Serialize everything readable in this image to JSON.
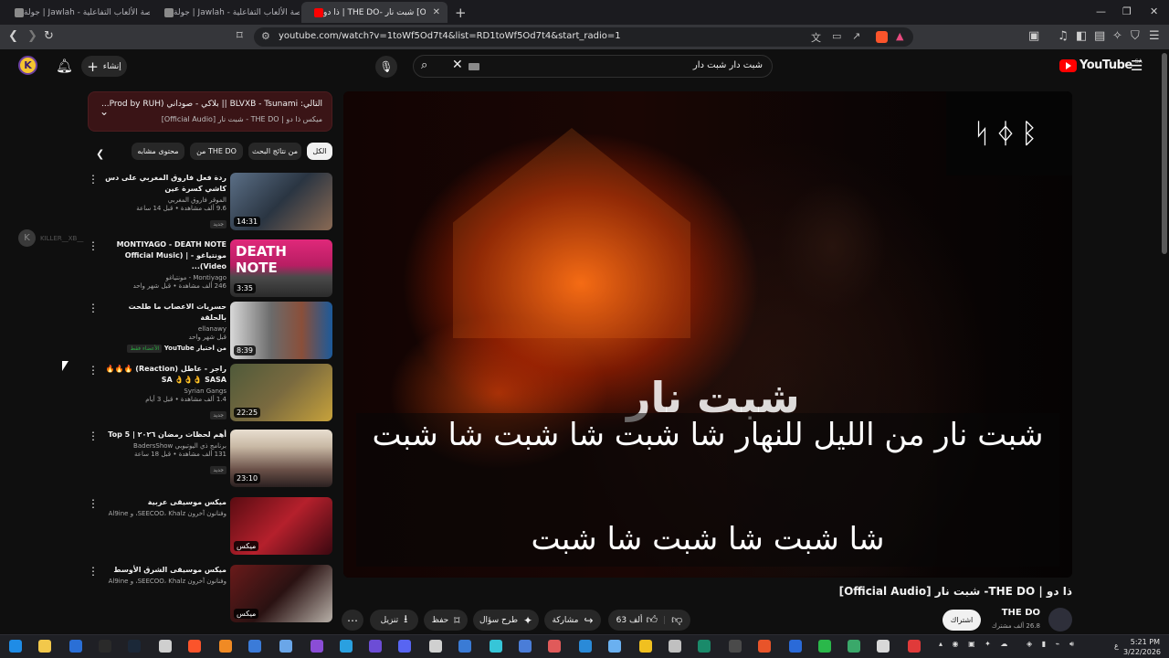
{
  "browser": {
    "tabs": [
      {
        "title": "جولة | Jawlah - منصة الألعاب التفاعلية",
        "active": false
      },
      {
        "title": "جولة | Jawlah - منصة الألعاب التفاعلية",
        "active": false
      },
      {
        "title": "ذا دو | THE DO- شبت نار [Official Audio]",
        "active": true
      }
    ],
    "url": "youtube.com/watch?v=1toWf5Od7t4&list=RD1toWf5Od7t4&start_radio=1"
  },
  "masthead": {
    "avatar_letter": "K",
    "create_label": "إنشاء",
    "search_query": "شبت دار شبت دار",
    "logo_text": "YouTube",
    "logo_country": "SA"
  },
  "upnext": {
    "line1": "التالي: BLVXB - Tsunami || بلاكي - صوداني (Prod by RUH...",
    "line2": "ميكس ذا دو | THE DO - شبت نار [Official Audio]"
  },
  "chips": [
    "الكل",
    "من نتائج البحث",
    "من THE DO",
    "محتوى مشابه"
  ],
  "sidebar_user": {
    "avatar": "K",
    "name": "KILLER__XB__"
  },
  "videos": [
    {
      "title": "ردة فعل فاروق المغربي على دس كاشي كسرة عين",
      "channel": "الموقر فاروق المغربي",
      "meta": "9.6 ألف مشاهدة • قبل 14 ساعة",
      "badge": "جديد",
      "duration": "14:31"
    },
    {
      "title": "MONTIYAGO - DEATH NOTE مونتياغو - | (Official Music Video)...",
      "channel": "Montiyago - مونتياغو",
      "meta": "246 ألف مشاهدة • قبل شهر واحد",
      "badge": "",
      "duration": "3:35"
    },
    {
      "title": "حسريات الاعصاب ما طلحت بالحلقة",
      "channel": "ellanawy",
      "meta": "قبل شهر واحد",
      "badge": "الأعضاء فقط",
      "extra": "من اختيار YouTube",
      "duration": "8:39"
    },
    {
      "title": "راجر - عاطل (Reaction) 🔥🔥🔥 SA 👌👌👌 SASA",
      "channel": "Syrian Gangs",
      "meta": "1.4 ألف مشاهدة • قبل 3 أيام",
      "badge": "جديد",
      "duration": "22:25"
    },
    {
      "title": "أهم لحظات رمضان ٢٠٢٦ | Top 5",
      "channel": "برنامج ذي اليوتيوبي BadersShow",
      "meta": "131 ألف مشاهدة • قبل 18 ساعة",
      "badge": "جديد",
      "duration": "23:10"
    },
    {
      "title": "ميكس موسيقى عربية",
      "channel": "وفنانون آخرون SEECOO، Khalz، و Al9ine",
      "meta": "",
      "badge": "",
      "duration": "ميكس"
    },
    {
      "title": "ميكس موسيقى الشرق الأوسط",
      "channel": "وفنانون آخرون SEECOO، Khalz، و Al9ine",
      "meta": "",
      "badge": "",
      "duration": "ميكس"
    }
  ],
  "player": {
    "logo_glyphs": "ᛋᛄᛒ",
    "overlay_text": "شبت نار",
    "subtitle_line1": "شبت نار من الليل للنهار شا شبت شا شبت شا شبت",
    "subtitle_line2": "شا شبت شا شبت شا شبت"
  },
  "video": {
    "title": "ذا دو | THE DO- شبت نار [Official Audio]",
    "channel_name": "THE DO",
    "channel_subs": "26.8 ألف مشترك",
    "subscribe_label": "اشتراك",
    "likes": "63 ألف",
    "share_label": "مشاركة",
    "ask_label": "طرح سؤال",
    "save_label": "حفظ",
    "download_label": "تنزيل"
  },
  "taskbar": {
    "time": "5:21 PM",
    "date": "3/22/2026",
    "lang": "ع"
  },
  "colors": {
    "accent_red": "#ff0000",
    "bg": "#0f0f0f",
    "chip_bg": "#272727",
    "upnext_bg": "#3a1416"
  }
}
